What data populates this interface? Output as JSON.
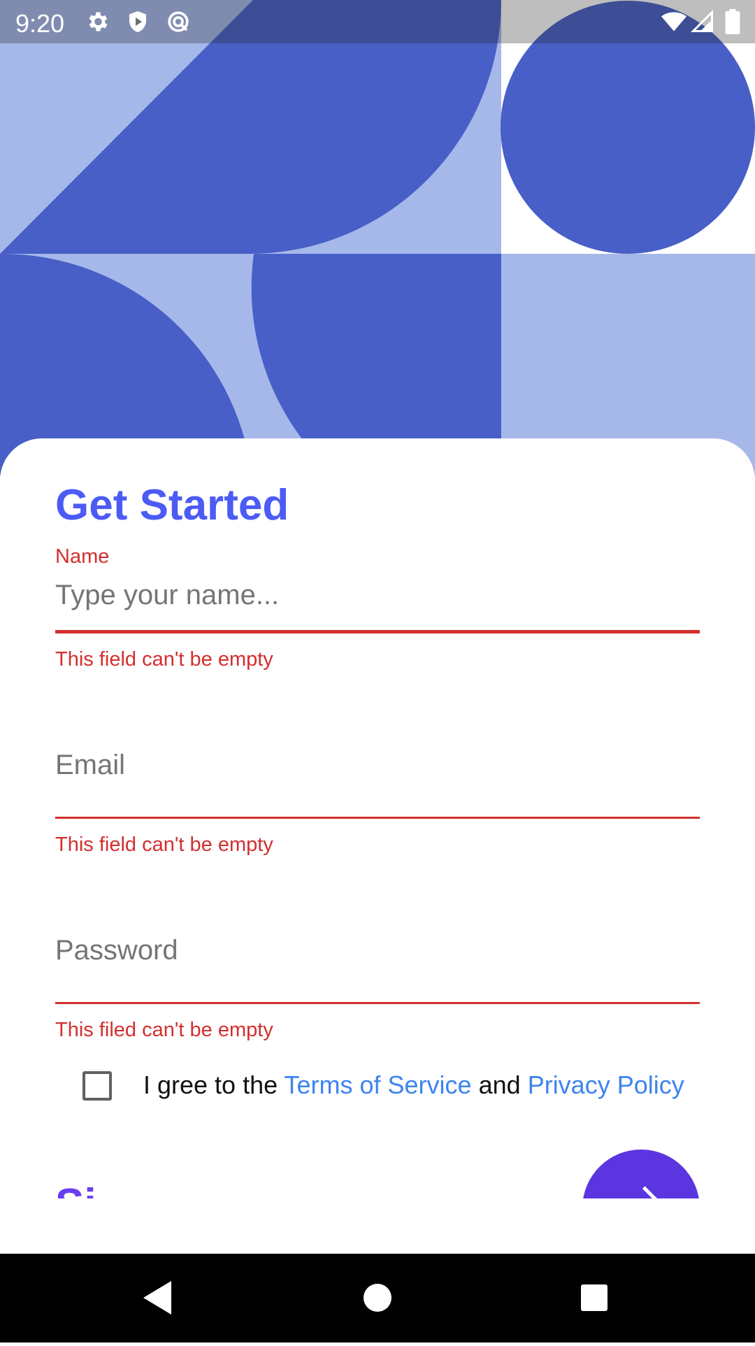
{
  "status_bar": {
    "time": "9:20",
    "left_icons": [
      "gear-icon",
      "shield-icon",
      "sync-icon"
    ],
    "right_icons": [
      "wifi-icon",
      "signal-icon",
      "battery-icon"
    ]
  },
  "form": {
    "title": "Get Started",
    "name": {
      "label": "Name",
      "placeholder": "Type your name...",
      "error": "This field can't be empty"
    },
    "email": {
      "placeholder": "Email",
      "error": "This field can't be empty"
    },
    "password": {
      "placeholder": "Password",
      "error": "This filed can't be empty"
    },
    "agreement": {
      "checked": false,
      "prefix": "I gree to the",
      "terms_link": "Terms of Service",
      "conjunction": "and",
      "privacy_link": "Privacy Policy"
    },
    "signin_label": "Si"
  },
  "nav_bar": {
    "buttons": [
      "back-icon",
      "home-icon",
      "recents-icon"
    ]
  },
  "colors": {
    "accent": "#4c5bf5",
    "error": "#d32f2f",
    "link": "#3d84f0",
    "fab": "#5b35e0",
    "hero_dark": "#475fc6",
    "hero_light": "#a6b8ea"
  }
}
